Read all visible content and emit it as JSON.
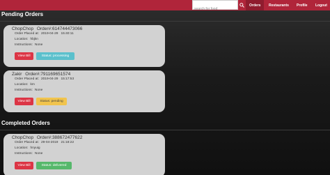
{
  "nav": {
    "search_placeholder": "search for food",
    "links": [
      "Orders",
      "Restaurants",
      "Profile",
      "Logout"
    ]
  },
  "pending": {
    "title": "Pending Orders",
    "orders": [
      {
        "restaurant": "ChopChop",
        "order_label": "Order#:",
        "order_number": "614744473066",
        "placed_label": "Order Placed at:",
        "placed_value": "2019-04-29   15:40:11",
        "location_label": "Location:",
        "location_value": "hbjkn",
        "instructions_label": "Instructions:",
        "instructions_value": "None",
        "bill_label": "View Bill",
        "status_label": "Status: processing"
      },
      {
        "restaurant": "Zakir",
        "order_label": "Order#:",
        "order_number": "791169651574",
        "placed_label": "Order Placed at:",
        "placed_value": "2019-04-29   15:17:53",
        "location_label": "Location:",
        "location_value": "km",
        "instructions_label": "Instructions:",
        "instructions_value": "None",
        "bill_label": "View Bill",
        "status_label": "Status: pending"
      }
    ]
  },
  "completed": {
    "title": "Completed Orders",
    "orders": [
      {
        "restaurant": "ChopChop",
        "order_label": "Order#:",
        "order_number": "388672477622",
        "placed_label": "Order Placed at:",
        "placed_value": "29-04-2019   21:18:22",
        "location_label": "Location:",
        "location_value": "hnyuig",
        "instructions_label": "Instructions:",
        "instructions_value": "None",
        "bill_label": "View Bill",
        "status_label": "Status: delivered"
      }
    ]
  },
  "colors": {
    "navbar": "#b0253a",
    "status_processing": "#5bc0cc",
    "status_pending": "#f1c44d",
    "status_delivered": "#56b86b",
    "view_bill": "#dc3545"
  },
  "icons": {
    "search": "search-icon"
  }
}
